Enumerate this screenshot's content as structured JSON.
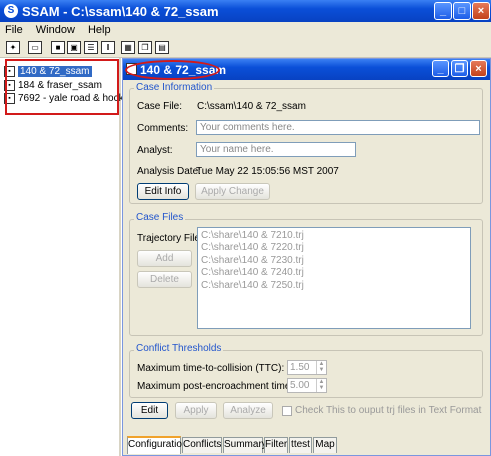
{
  "window": {
    "title": "SSAM - C:\\ssam\\140 & 72_ssam",
    "app_icon": "S"
  },
  "menu": [
    "File",
    "Window",
    "Help"
  ],
  "toolbar_icons": [
    "new-icon",
    "open-icon",
    "save-icon",
    "save-all-icon",
    "split-horizontal-icon",
    "split-vertical-icon",
    "tile-icon",
    "cascade-icon",
    "calculator-icon"
  ],
  "tree": [
    {
      "label": "140 & 72_ssam",
      "selected": true
    },
    {
      "label": "184 & fraser_ssam",
      "selected": false
    },
    {
      "label": "7692 - yale road & hocking",
      "selected": false
    }
  ],
  "child_window": {
    "title": "140 & 72_ssam"
  },
  "case_info": {
    "group_label": "Case Information",
    "case_file_label": "Case File:",
    "case_file_value": "C:\\ssam\\140 & 72_ssam",
    "comments_label": "Comments:",
    "comments_placeholder": "Your comments here.",
    "analyst_label": "Analyst:",
    "analyst_placeholder": "Your name here.",
    "date_label": "Analysis Date:",
    "date_value": "Tue May 22 15:05:56 MST 2007",
    "edit_info": "Edit Info",
    "apply_change": "Apply Change"
  },
  "case_files": {
    "group_label": "Case Files",
    "traj_label": "Trajectory Files:",
    "add": "Add",
    "delete": "Delete",
    "files": [
      "C:\\share\\140 & 7210.trj",
      "C:\\share\\140 & 7220.trj",
      "C:\\share\\140 & 7230.trj",
      "C:\\share\\140 & 7240.trj",
      "C:\\share\\140 & 7250.trj"
    ]
  },
  "thresholds": {
    "group_label": "Conflict Thresholds",
    "ttc_label": "Maximum time-to-collision (TTC):",
    "ttc_value": "1.50",
    "pet_label": "Maximum post-encroachment time (PET):",
    "pet_value": "5.00"
  },
  "actions": {
    "edit": "Edit",
    "apply": "Apply",
    "analyze": "Analyze",
    "checkbox_label": "Check This to ouput trj files in Text Format"
  },
  "tabs": [
    "Configuration",
    "Conflicts",
    "Summary",
    "Filter",
    "ttest",
    "Map"
  ]
}
